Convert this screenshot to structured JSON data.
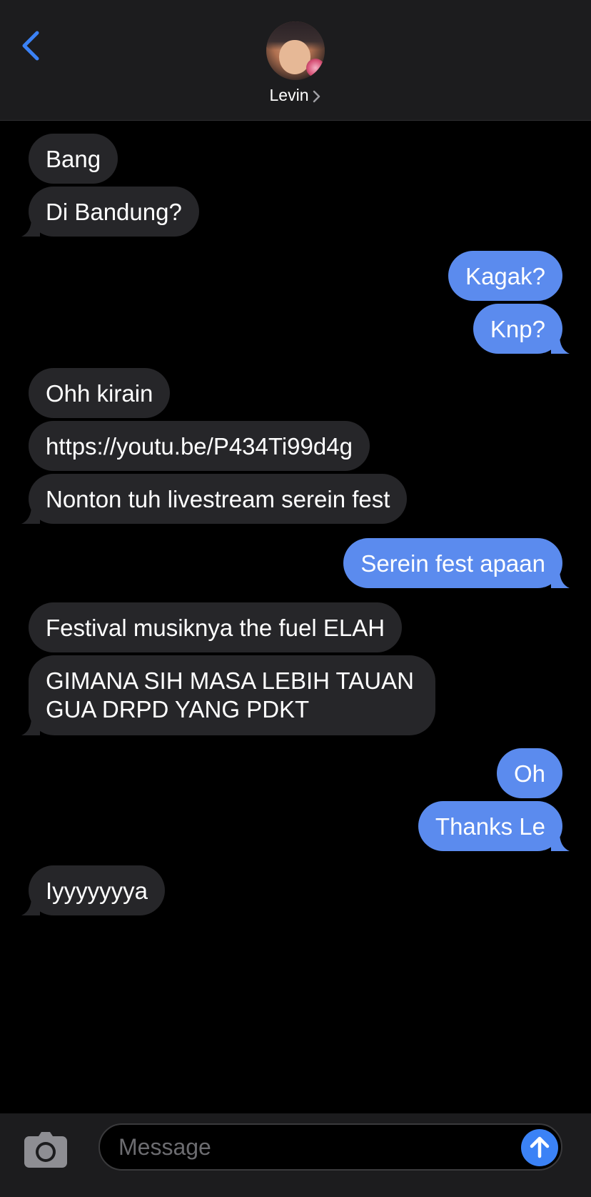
{
  "header": {
    "contact_name": "Levin",
    "accent_color": "#3b82f6"
  },
  "messages": [
    {
      "direction": "received",
      "text": "Bang"
    },
    {
      "direction": "received",
      "text": "Di Bandung?"
    },
    {
      "direction": "sent",
      "text": "Kagak?"
    },
    {
      "direction": "sent",
      "text": "Knp?"
    },
    {
      "direction": "received",
      "text": "Ohh kirain"
    },
    {
      "direction": "received",
      "text": "https://youtu.be/P434Ti99d4g"
    },
    {
      "direction": "received",
      "text": "Nonton tuh livestream serein fest"
    },
    {
      "direction": "sent",
      "text": "Serein fest apaan"
    },
    {
      "direction": "received",
      "text": "Festival musiknya the fuel ELAH"
    },
    {
      "direction": "received",
      "text": "GIMANA SIH MASA LEBIH TAUAN GUA DRPD YANG PDKT"
    },
    {
      "direction": "sent",
      "text": "Oh"
    },
    {
      "direction": "sent",
      "text": "Thanks Le"
    },
    {
      "direction": "received",
      "text": "Iyyyyyyya"
    }
  ],
  "input": {
    "placeholder": "Message",
    "value": ""
  },
  "colors": {
    "sent_bubble": "#5b8bee",
    "received_bubble": "#262629",
    "background": "#000000"
  },
  "icons": {
    "back": "chevron-left-icon",
    "camera": "camera-icon",
    "send": "arrow-up-icon"
  }
}
